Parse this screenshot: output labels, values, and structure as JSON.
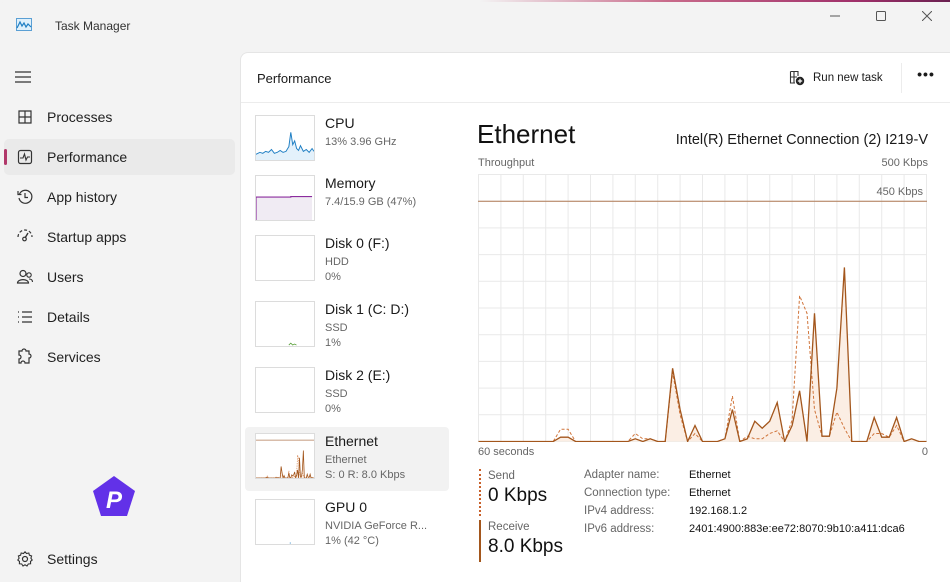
{
  "window": {
    "title": "Task Manager",
    "controls": {
      "minimize": "minimize",
      "maximize": "maximize",
      "close": "close"
    }
  },
  "sidebar": {
    "menu_icon": "hamburger-icon",
    "items": [
      {
        "label": "Processes",
        "icon": "processes-grid-icon",
        "active": false
      },
      {
        "label": "Performance",
        "icon": "performance-pulse-icon",
        "active": true
      },
      {
        "label": "App history",
        "icon": "history-clock-icon",
        "active": false
      },
      {
        "label": "Startup apps",
        "icon": "speedometer-icon",
        "active": false
      },
      {
        "label": "Users",
        "icon": "users-icon",
        "active": false
      },
      {
        "label": "Details",
        "icon": "list-details-icon",
        "active": false
      },
      {
        "label": "Services",
        "icon": "services-puzzle-icon",
        "active": false
      }
    ],
    "settings_label": "Settings",
    "accent": "#b1386a"
  },
  "header": {
    "title": "Performance",
    "run_task_label": "Run new task",
    "more_label": "•••"
  },
  "devices": [
    {
      "name": "CPU",
      "sub1": "13%  3.96 GHz",
      "sub2": "",
      "active": false,
      "color": "#1f7fc4"
    },
    {
      "name": "Memory",
      "sub1": "7.4/15.9 GB (47%)",
      "sub2": "",
      "active": false,
      "color": "#8b2c9e"
    },
    {
      "name": "Disk 0 (F:)",
      "sub1": "HDD",
      "sub2": "0%",
      "active": false,
      "color": "#4d9a2c"
    },
    {
      "name": "Disk 1 (C: D:)",
      "sub1": "SSD",
      "sub2": "1%",
      "active": false,
      "color": "#4d9a2c"
    },
    {
      "name": "Disk 2 (E:)",
      "sub1": "SSD",
      "sub2": "0%",
      "active": false,
      "color": "#4d9a2c"
    },
    {
      "name": "Ethernet",
      "sub1": "Ethernet",
      "sub2": "S: 0 R: 8.0 Kbps",
      "active": true,
      "color": "#a3561c"
    },
    {
      "name": "GPU 0",
      "sub1": "NVIDIA GeForce R...",
      "sub2": "1%  (42 °C)",
      "active": false,
      "color": "#1f7fc4"
    }
  ],
  "detail": {
    "title": "Ethernet",
    "adapter": "Intel(R) Ethernet Connection (2) I219-V",
    "throughput_label": "Throughput",
    "max_label": "500 Kbps",
    "time_label_left": "60 seconds",
    "time_label_right": "0",
    "send_label": "Send",
    "send_value": "0 Kbps",
    "receive_label": "Receive",
    "receive_value": "8.0 Kbps",
    "properties": [
      {
        "key": "Adapter name:",
        "value": "Ethernet"
      },
      {
        "key": "Connection type:",
        "value": "Ethernet"
      },
      {
        "key": "IPv4 address:",
        "value": "192.168.1.2"
      },
      {
        "key": "IPv6 address:",
        "value": "2401:4900:883e:ee72:8070:9b10:a411:dca6"
      }
    ]
  },
  "chart_data": {
    "type": "area",
    "title": "Throughput",
    "xlabel": "60 seconds",
    "ylabel": "Kbps",
    "ylim": [
      0,
      500
    ],
    "xlim": [
      60,
      0
    ],
    "grid": true,
    "reference_line": {
      "value": 450,
      "label": "450 Kbps"
    },
    "colors": {
      "receive": "#a3561c",
      "send": "#d0743a",
      "fill": "#fbeee4",
      "grid": "#e9e9e9"
    },
    "x": [
      60,
      59,
      58,
      57,
      56,
      55,
      54,
      53,
      52,
      51,
      50,
      49,
      48,
      47,
      46,
      45,
      44,
      43,
      42,
      41,
      40,
      39,
      38,
      37,
      36,
      35,
      34,
      33,
      32,
      31,
      30,
      29,
      28,
      27,
      26,
      25,
      24,
      23,
      22,
      21,
      20,
      19,
      18,
      17,
      16,
      15,
      14,
      13,
      12,
      11,
      10,
      9,
      8,
      7,
      6,
      5,
      4,
      3,
      2,
      1,
      0
    ],
    "series": [
      {
        "name": "Receive",
        "style": "solid",
        "values": [
          0,
          0,
          0,
          0,
          0,
          0,
          0,
          0,
          0,
          0,
          0,
          8,
          8,
          0,
          0,
          0,
          0,
          0,
          0,
          0,
          0,
          5,
          0,
          5,
          0,
          0,
          137,
          60,
          0,
          30,
          0,
          0,
          0,
          5,
          60,
          0,
          5,
          38,
          25,
          38,
          73,
          0,
          30,
          95,
          0,
          240,
          10,
          10,
          100,
          326,
          0,
          0,
          0,
          45,
          8,
          8,
          45,
          0,
          5,
          0,
          0
        ]
      },
      {
        "name": "Send",
        "style": "dashed",
        "values": [
          0,
          0,
          0,
          0,
          0,
          0,
          0,
          0,
          0,
          0,
          0,
          23,
          23,
          0,
          0,
          0,
          0,
          0,
          0,
          0,
          0,
          15,
          5,
          5,
          0,
          0,
          130,
          50,
          0,
          15,
          0,
          0,
          0,
          5,
          85,
          0,
          10,
          5,
          5,
          15,
          20,
          0,
          40,
          273,
          240,
          60,
          10,
          10,
          55,
          25,
          0,
          0,
          0,
          15,
          15,
          8,
          30,
          0,
          5,
          0,
          0
        ]
      }
    ]
  }
}
